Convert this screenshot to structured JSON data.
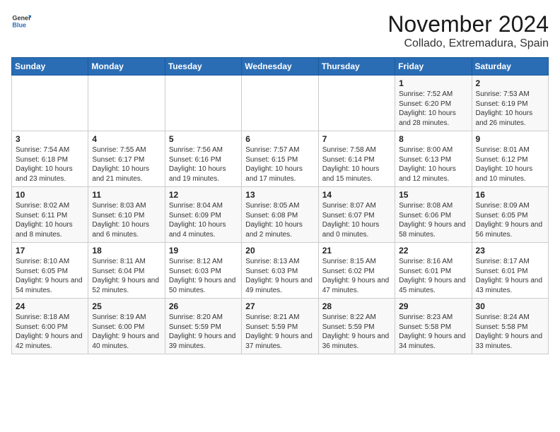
{
  "logo": {
    "line1": "General",
    "line2": "Blue"
  },
  "title": "November 2024",
  "location": "Collado, Extremadura, Spain",
  "weekdays": [
    "Sunday",
    "Monday",
    "Tuesday",
    "Wednesday",
    "Thursday",
    "Friday",
    "Saturday"
  ],
  "weeks": [
    [
      {
        "day": "",
        "sunrise": "",
        "sunset": "",
        "daylight": ""
      },
      {
        "day": "",
        "sunrise": "",
        "sunset": "",
        "daylight": ""
      },
      {
        "day": "",
        "sunrise": "",
        "sunset": "",
        "daylight": ""
      },
      {
        "day": "",
        "sunrise": "",
        "sunset": "",
        "daylight": ""
      },
      {
        "day": "",
        "sunrise": "",
        "sunset": "",
        "daylight": ""
      },
      {
        "day": "1",
        "sunrise": "Sunrise: 7:52 AM",
        "sunset": "Sunset: 6:20 PM",
        "daylight": "Daylight: 10 hours and 28 minutes."
      },
      {
        "day": "2",
        "sunrise": "Sunrise: 7:53 AM",
        "sunset": "Sunset: 6:19 PM",
        "daylight": "Daylight: 10 hours and 26 minutes."
      }
    ],
    [
      {
        "day": "3",
        "sunrise": "Sunrise: 7:54 AM",
        "sunset": "Sunset: 6:18 PM",
        "daylight": "Daylight: 10 hours and 23 minutes."
      },
      {
        "day": "4",
        "sunrise": "Sunrise: 7:55 AM",
        "sunset": "Sunset: 6:17 PM",
        "daylight": "Daylight: 10 hours and 21 minutes."
      },
      {
        "day": "5",
        "sunrise": "Sunrise: 7:56 AM",
        "sunset": "Sunset: 6:16 PM",
        "daylight": "Daylight: 10 hours and 19 minutes."
      },
      {
        "day": "6",
        "sunrise": "Sunrise: 7:57 AM",
        "sunset": "Sunset: 6:15 PM",
        "daylight": "Daylight: 10 hours and 17 minutes."
      },
      {
        "day": "7",
        "sunrise": "Sunrise: 7:58 AM",
        "sunset": "Sunset: 6:14 PM",
        "daylight": "Daylight: 10 hours and 15 minutes."
      },
      {
        "day": "8",
        "sunrise": "Sunrise: 8:00 AM",
        "sunset": "Sunset: 6:13 PM",
        "daylight": "Daylight: 10 hours and 12 minutes."
      },
      {
        "day": "9",
        "sunrise": "Sunrise: 8:01 AM",
        "sunset": "Sunset: 6:12 PM",
        "daylight": "Daylight: 10 hours and 10 minutes."
      }
    ],
    [
      {
        "day": "10",
        "sunrise": "Sunrise: 8:02 AM",
        "sunset": "Sunset: 6:11 PM",
        "daylight": "Daylight: 10 hours and 8 minutes."
      },
      {
        "day": "11",
        "sunrise": "Sunrise: 8:03 AM",
        "sunset": "Sunset: 6:10 PM",
        "daylight": "Daylight: 10 hours and 6 minutes."
      },
      {
        "day": "12",
        "sunrise": "Sunrise: 8:04 AM",
        "sunset": "Sunset: 6:09 PM",
        "daylight": "Daylight: 10 hours and 4 minutes."
      },
      {
        "day": "13",
        "sunrise": "Sunrise: 8:05 AM",
        "sunset": "Sunset: 6:08 PM",
        "daylight": "Daylight: 10 hours and 2 minutes."
      },
      {
        "day": "14",
        "sunrise": "Sunrise: 8:07 AM",
        "sunset": "Sunset: 6:07 PM",
        "daylight": "Daylight: 10 hours and 0 minutes."
      },
      {
        "day": "15",
        "sunrise": "Sunrise: 8:08 AM",
        "sunset": "Sunset: 6:06 PM",
        "daylight": "Daylight: 9 hours and 58 minutes."
      },
      {
        "day": "16",
        "sunrise": "Sunrise: 8:09 AM",
        "sunset": "Sunset: 6:05 PM",
        "daylight": "Daylight: 9 hours and 56 minutes."
      }
    ],
    [
      {
        "day": "17",
        "sunrise": "Sunrise: 8:10 AM",
        "sunset": "Sunset: 6:05 PM",
        "daylight": "Daylight: 9 hours and 54 minutes."
      },
      {
        "day": "18",
        "sunrise": "Sunrise: 8:11 AM",
        "sunset": "Sunset: 6:04 PM",
        "daylight": "Daylight: 9 hours and 52 minutes."
      },
      {
        "day": "19",
        "sunrise": "Sunrise: 8:12 AM",
        "sunset": "Sunset: 6:03 PM",
        "daylight": "Daylight: 9 hours and 50 minutes."
      },
      {
        "day": "20",
        "sunrise": "Sunrise: 8:13 AM",
        "sunset": "Sunset: 6:03 PM",
        "daylight": "Daylight: 9 hours and 49 minutes."
      },
      {
        "day": "21",
        "sunrise": "Sunrise: 8:15 AM",
        "sunset": "Sunset: 6:02 PM",
        "daylight": "Daylight: 9 hours and 47 minutes."
      },
      {
        "day": "22",
        "sunrise": "Sunrise: 8:16 AM",
        "sunset": "Sunset: 6:01 PM",
        "daylight": "Daylight: 9 hours and 45 minutes."
      },
      {
        "day": "23",
        "sunrise": "Sunrise: 8:17 AM",
        "sunset": "Sunset: 6:01 PM",
        "daylight": "Daylight: 9 hours and 43 minutes."
      }
    ],
    [
      {
        "day": "24",
        "sunrise": "Sunrise: 8:18 AM",
        "sunset": "Sunset: 6:00 PM",
        "daylight": "Daylight: 9 hours and 42 minutes."
      },
      {
        "day": "25",
        "sunrise": "Sunrise: 8:19 AM",
        "sunset": "Sunset: 6:00 PM",
        "daylight": "Daylight: 9 hours and 40 minutes."
      },
      {
        "day": "26",
        "sunrise": "Sunrise: 8:20 AM",
        "sunset": "Sunset: 5:59 PM",
        "daylight": "Daylight: 9 hours and 39 minutes."
      },
      {
        "day": "27",
        "sunrise": "Sunrise: 8:21 AM",
        "sunset": "Sunset: 5:59 PM",
        "daylight": "Daylight: 9 hours and 37 minutes."
      },
      {
        "day": "28",
        "sunrise": "Sunrise: 8:22 AM",
        "sunset": "Sunset: 5:59 PM",
        "daylight": "Daylight: 9 hours and 36 minutes."
      },
      {
        "day": "29",
        "sunrise": "Sunrise: 8:23 AM",
        "sunset": "Sunset: 5:58 PM",
        "daylight": "Daylight: 9 hours and 34 minutes."
      },
      {
        "day": "30",
        "sunrise": "Sunrise: 8:24 AM",
        "sunset": "Sunset: 5:58 PM",
        "daylight": "Daylight: 9 hours and 33 minutes."
      }
    ]
  ]
}
